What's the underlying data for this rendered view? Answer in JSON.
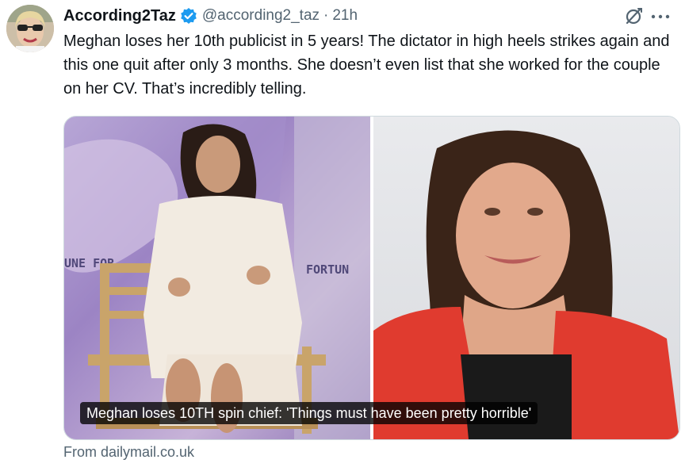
{
  "tweet": {
    "author": {
      "display_name": "According2Taz",
      "handle": "@according2_taz",
      "verified": true
    },
    "separator": "·",
    "time": "21h",
    "text": "Meghan loses her 10th publicist in 5 years! The dictator in high heels strikes again and this one quit after only 3 months. She doesn’t even list that she worked for the couple on her CV. That’s incredibly telling.",
    "card": {
      "caption": "Meghan loses 10TH spin chief: 'Things must have been pretty horrible'",
      "source": "From dailymail.co.uk",
      "left_backdrop_text": "UNE FOR",
      "left_backdrop_text_2": "FORTUN"
    },
    "icons": [
      "verified-badge-icon",
      "grok-icon",
      "more-icon"
    ]
  },
  "colors": {
    "verified_blue": "#1d9bf0",
    "secondary_text": "#536471",
    "primary_text": "#0f1419",
    "border": "#cfd9de"
  }
}
